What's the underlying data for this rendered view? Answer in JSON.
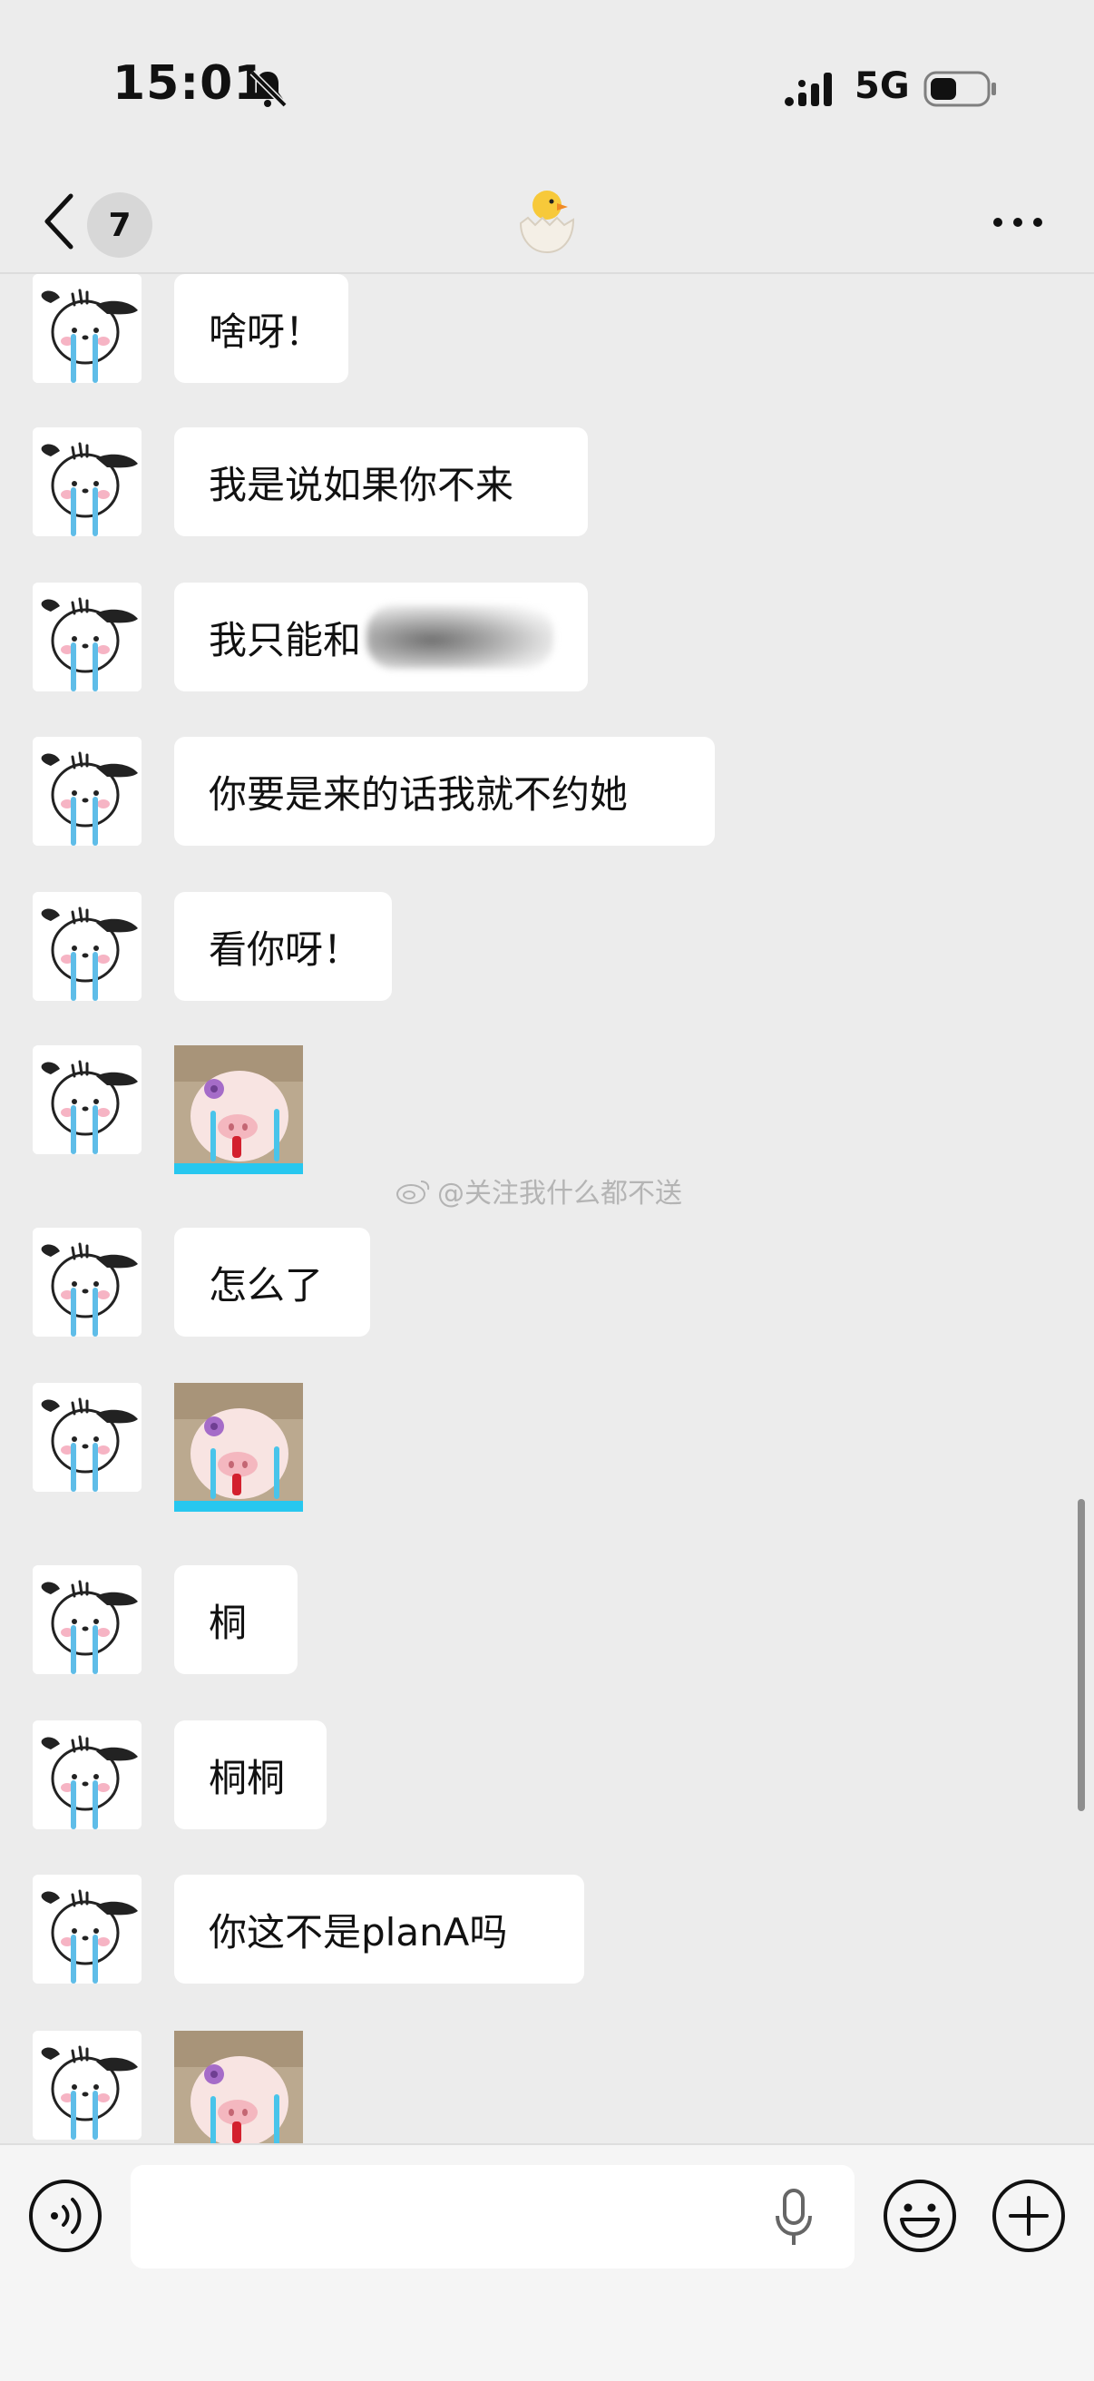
{
  "status_bar": {
    "time": "15:01",
    "network": "5G",
    "icons": [
      "bell-muted-icon",
      "signal-icon",
      "battery-icon"
    ]
  },
  "nav": {
    "unread_count": "7",
    "icons": [
      "back-chevron-icon",
      "hatching-chick-icon",
      "more-icon"
    ]
  },
  "messages": [
    {
      "type": "text",
      "text": "啥呀！"
    },
    {
      "type": "text",
      "text": "我是说如果你不来"
    },
    {
      "type": "text",
      "text": "我只能和",
      "blurred": true
    },
    {
      "type": "text",
      "text": "你要是来的话我就不约她"
    },
    {
      "type": "text",
      "text": "看你呀！"
    },
    {
      "type": "sticker",
      "sticker": "crying-pig-sticker"
    },
    {
      "type": "text",
      "text": "怎么了"
    },
    {
      "type": "sticker",
      "sticker": "crying-pig-sticker"
    },
    {
      "type": "text",
      "text": "桐"
    },
    {
      "type": "text",
      "text": "桐桐"
    },
    {
      "type": "text",
      "text": "你这不是planA吗"
    },
    {
      "type": "sticker",
      "sticker": "crying-pig-sticker"
    }
  ],
  "watermark": "@关注我什么都不送",
  "input_bar": {
    "placeholder": "",
    "icons": [
      "voice-icon",
      "microphone-icon",
      "emoji-icon",
      "plus-icon"
    ]
  },
  "colors": {
    "background": "#ececec",
    "bubble": "#ffffff",
    "input_bar": "#f5f5f5"
  }
}
